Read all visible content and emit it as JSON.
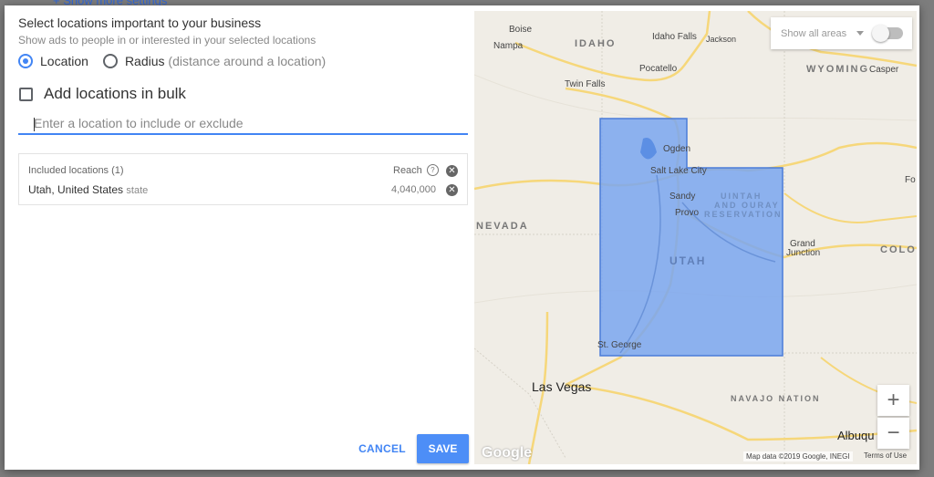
{
  "background": {
    "link": "+ Show more settings"
  },
  "dialog": {
    "title": "Select locations important to your business",
    "subtitle": "Show ads to people in or interested in your selected locations",
    "radio_location": "Location",
    "radio_radius": "Radius",
    "radio_radius_hint": "(distance around a location)",
    "bulk_label": "Add locations in bulk",
    "search_placeholder": "Enter a location to include or exclude",
    "included_header": "Included locations (1)",
    "reach_header": "Reach",
    "locations": [
      {
        "name": "Utah, United States",
        "type": "state",
        "reach": "4,040,000"
      }
    ],
    "cancel": "CANCEL",
    "save": "SAVE"
  },
  "map": {
    "show_areas": "Show all areas",
    "zoom_in": "+",
    "zoom_out": "−",
    "attribution": "Map data ©2019 Google, INEGI",
    "terms": "Terms of Use",
    "logo": "Google",
    "places": {
      "boise": "Boise",
      "nampa": "Nampa",
      "idaho": "IDAHO",
      "idaho_falls": "Idaho Falls",
      "jackson": "Jackson",
      "wyoming": "WYOMING",
      "casper": "Casper",
      "pocatello": "Pocatello",
      "twin_falls": "Twin Falls",
      "ogden": "Ogden",
      "slc": "Salt Lake City",
      "sandy": "Sandy",
      "provo": "Provo",
      "uintah1": "UINTAH",
      "uintah2": "AND OURAY",
      "uintah3": "RESERVATION",
      "nevada": "NEVADA",
      "utah": "UTAH",
      "grand1": "Grand",
      "grand2": "Junction",
      "colo": "COLO",
      "fo": "Fo",
      "st_george": "St. George",
      "las_vegas": "Las Vegas",
      "navajo": "NAVAJO NATION",
      "albuq": "Albuqu"
    }
  },
  "colors": {
    "accent": "#4285f4",
    "highlight": "#7aa6ee"
  }
}
